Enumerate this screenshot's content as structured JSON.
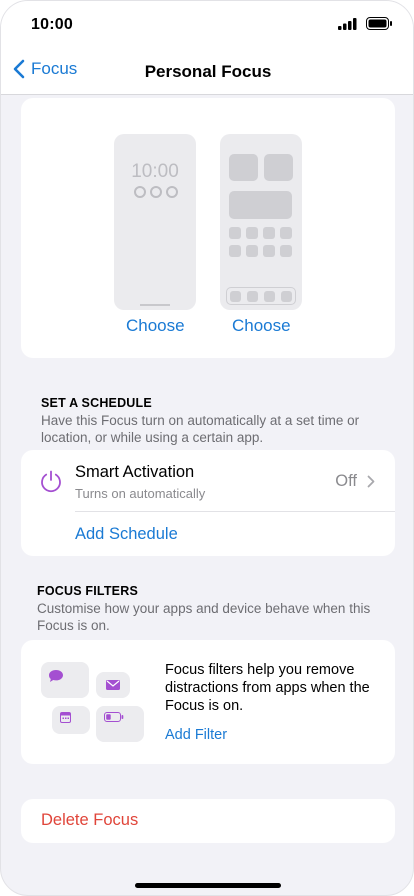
{
  "status_bar": {
    "time": "10:00"
  },
  "nav": {
    "back_label": "Focus",
    "title": "Personal Focus"
  },
  "previews": {
    "lock_time": "10:00",
    "choose_lock": "Choose",
    "choose_home": "Choose"
  },
  "schedule": {
    "header": "SET A SCHEDULE",
    "description": "Have this Focus turn on automatically at a set time or location, or while using a certain app.",
    "smart_activation_title": "Smart Activation",
    "smart_activation_subtitle": "Turns on automatically",
    "smart_activation_value": "Off",
    "add_schedule": "Add Schedule"
  },
  "filters": {
    "header": "FOCUS FILTERS",
    "description": "Customise how your apps and device behave when this Focus is on.",
    "body": "Focus filters help you remove distractions from apps when the Focus is on.",
    "add_filter": "Add Filter"
  },
  "delete": {
    "label": "Delete Focus"
  },
  "colors": {
    "accent": "#1a7ad4",
    "purple": "#a44fd1",
    "destructive": "#e0453a",
    "background": "#f2f2f7"
  },
  "icons": [
    "signal-icon",
    "battery-icon",
    "chevron-left-icon",
    "power-icon",
    "chevron-right-icon",
    "message-icon",
    "mail-icon",
    "calendar-icon",
    "battery-low-icon"
  ]
}
